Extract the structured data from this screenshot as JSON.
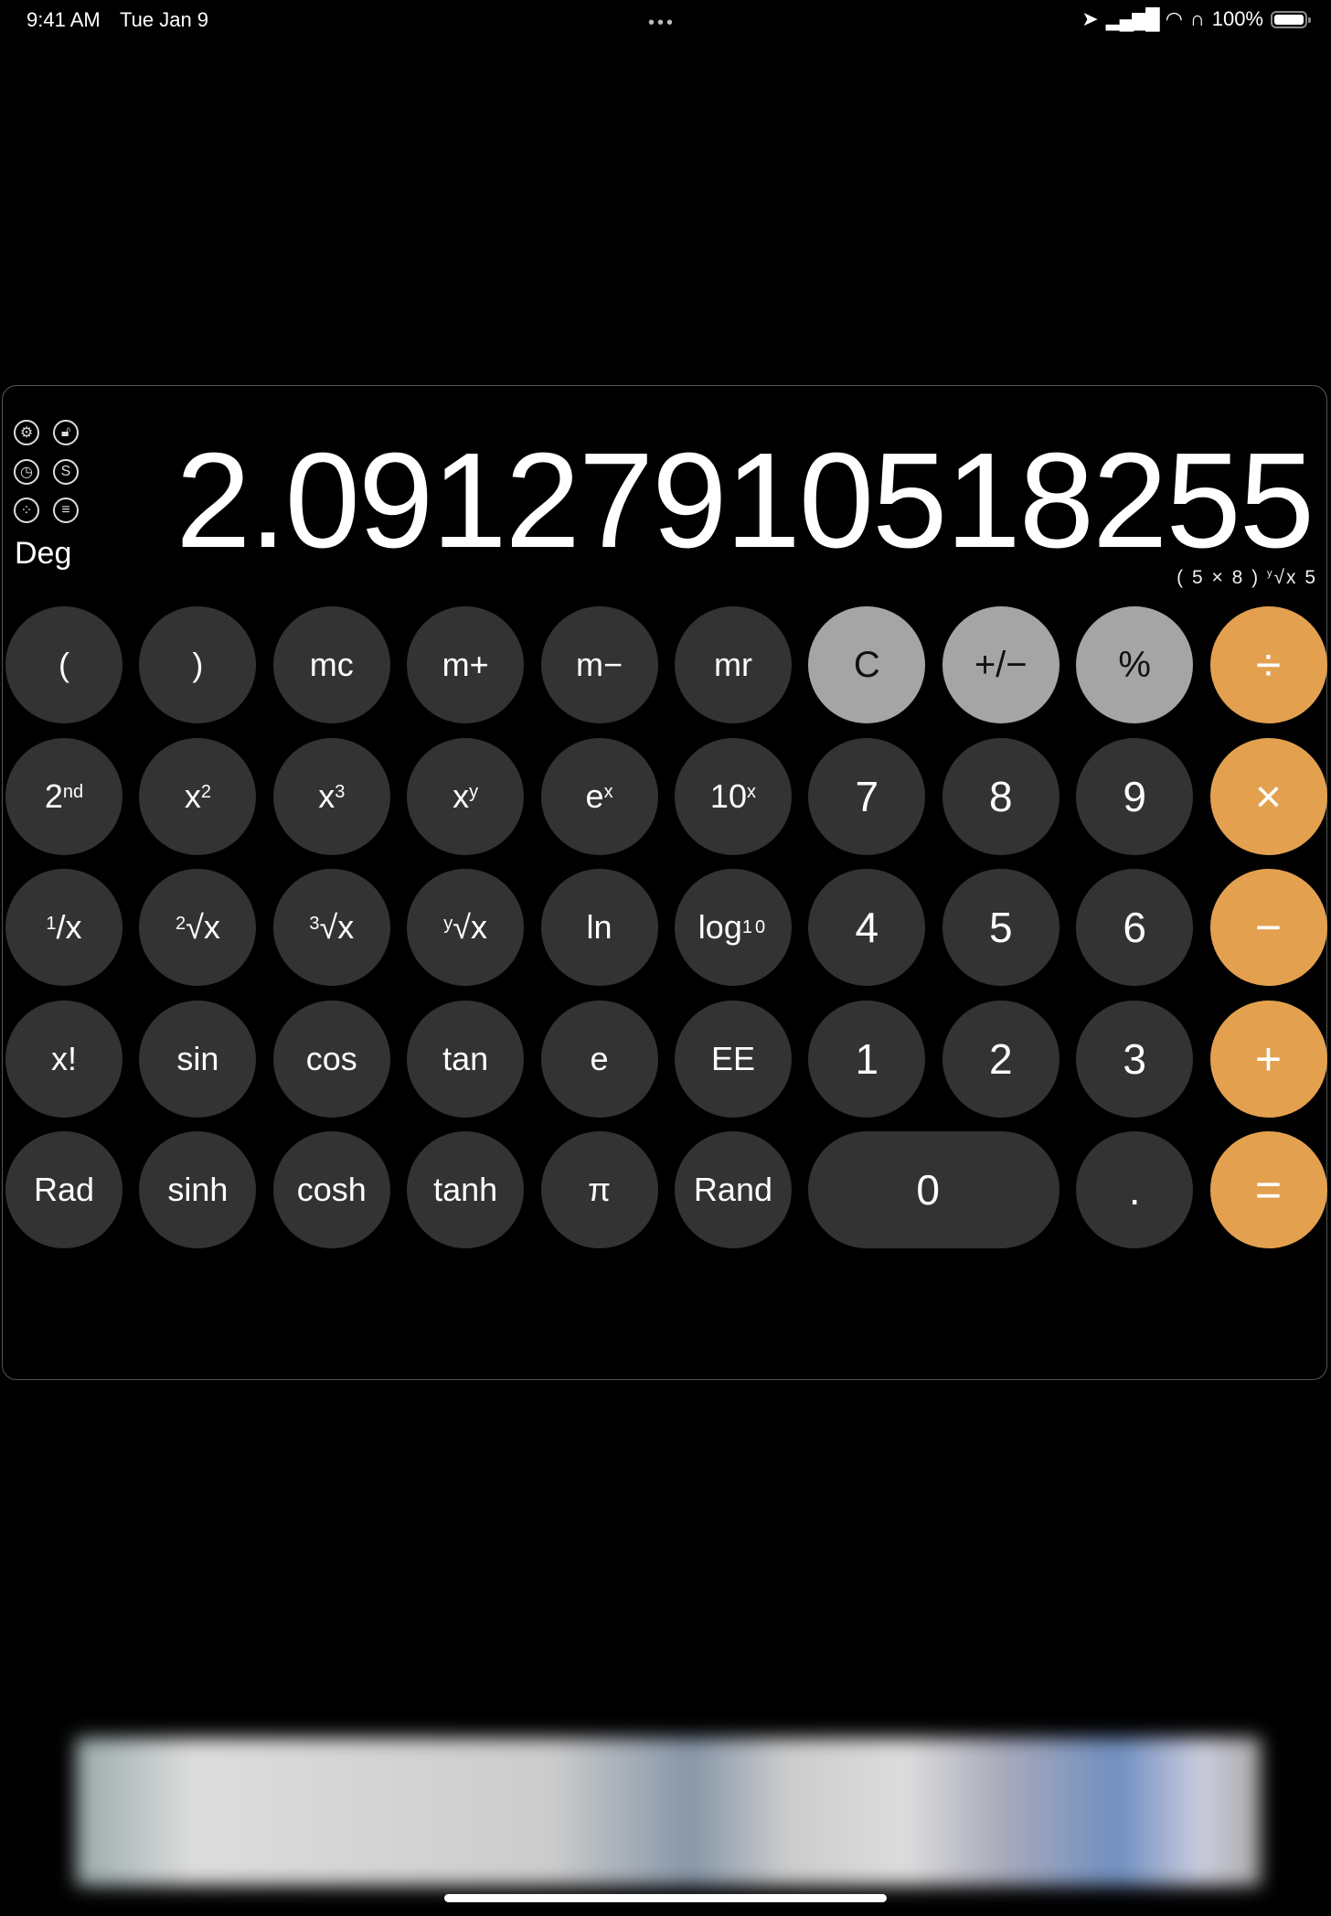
{
  "status_bar": {
    "time": "9:41 AM",
    "date": "Tue Jan 9",
    "battery": "100%",
    "icons": [
      "location-icon",
      "signal-icon",
      "wifi-icon",
      "headphones-icon",
      "battery-icon"
    ]
  },
  "side_icons": [
    {
      "name": "settings-icon",
      "glyph": "⚙"
    },
    {
      "name": "lock-icon",
      "glyph": "🔓︎"
    },
    {
      "name": "history-icon",
      "glyph": "◷"
    },
    {
      "name": "s-icon",
      "glyph": "S"
    },
    {
      "name": "themes-icon",
      "glyph": "⁘"
    },
    {
      "name": "menu-icon",
      "glyph": "≡"
    }
  ],
  "angle_mode": "Deg",
  "display": "2.0912791051825 5",
  "display_value": "2.09127910518255",
  "expression": {
    "pre": "( 5 × 8 ) ",
    "sup": "y",
    "post": "√x 5"
  },
  "colors": {
    "dark": "#333333",
    "light": "#a5a5a5",
    "orange": "#e3a14f"
  },
  "buttons": [
    {
      "l": "("
    },
    {
      "l": ")"
    },
    {
      "l": "mc"
    },
    {
      "l": "m+"
    },
    {
      "l": "m−"
    },
    {
      "l": "mr"
    },
    {
      "l": "C",
      "t": "light"
    },
    {
      "l": "+/−",
      "t": "light"
    },
    {
      "l": "%",
      "t": "light"
    },
    {
      "l": "÷",
      "t": "orange"
    },
    {
      "l": "2",
      "sup": "nd"
    },
    {
      "l": "x",
      "sup": "2"
    },
    {
      "l": "x",
      "sup": "3"
    },
    {
      "l": "x",
      "sup": "y"
    },
    {
      "l": "e",
      "sup": "x"
    },
    {
      "l": "10",
      "sup": "x"
    },
    {
      "l": "7",
      "t": "num"
    },
    {
      "l": "8",
      "t": "num"
    },
    {
      "l": "9",
      "t": "num"
    },
    {
      "l": "×",
      "t": "orange"
    },
    {
      "pre": "1",
      "l": "/x"
    },
    {
      "pre": "2",
      "l": "√x"
    },
    {
      "pre": "3",
      "l": "√x"
    },
    {
      "pre": "y",
      "l": "√x"
    },
    {
      "l": "ln"
    },
    {
      "l": "log",
      "sub": "10"
    },
    {
      "l": "4",
      "t": "num"
    },
    {
      "l": "5",
      "t": "num"
    },
    {
      "l": "6",
      "t": "num"
    },
    {
      "l": "−",
      "t": "orange"
    },
    {
      "l": "x!"
    },
    {
      "l": "sin"
    },
    {
      "l": "cos"
    },
    {
      "l": "tan"
    },
    {
      "l": "e"
    },
    {
      "l": "EE"
    },
    {
      "l": "1",
      "t": "num"
    },
    {
      "l": "2",
      "t": "num"
    },
    {
      "l": "3",
      "t": "num"
    },
    {
      "l": "+",
      "t": "orange"
    },
    {
      "l": "Rad"
    },
    {
      "l": "sinh"
    },
    {
      "l": "cosh"
    },
    {
      "l": "tanh"
    },
    {
      "l": "π"
    },
    {
      "l": "Rand"
    },
    {
      "l": "0",
      "t": "num wide"
    },
    {
      "l": ".",
      "t": "num"
    },
    {
      "l": "=",
      "t": "orange"
    }
  ]
}
